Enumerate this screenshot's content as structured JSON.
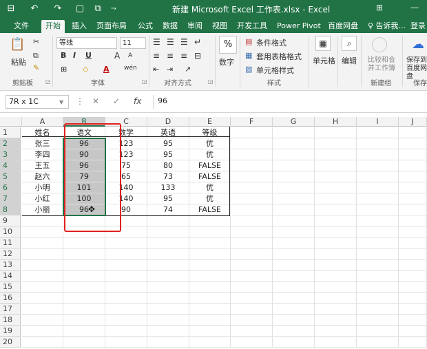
{
  "titlebar": {
    "quick_access": [
      "⊟",
      "↶",
      "↷",
      "▢",
      "⧉",
      "⇁"
    ],
    "title": "新建 Microsoft Excel 工作表.xlsx - Excel",
    "window_icon": "⊞",
    "minimize": "—"
  },
  "tabs": [
    "文件",
    "开始",
    "插入",
    "页面布局",
    "公式",
    "数据",
    "审阅",
    "视图",
    "开发工具",
    "Power Pivot",
    "百度网盘",
    "♀ 告诉我...",
    "登录"
  ],
  "active_tab": 1,
  "ribbon": {
    "clipboard": {
      "paste": "粘贴",
      "label": "剪贴板",
      "icons": [
        "✂",
        "⧉",
        "✎"
      ]
    },
    "font": {
      "name": "等线",
      "size": "11",
      "bold": "B",
      "italic": "I",
      "underline": "U",
      "grow": "A",
      "shrink": "A",
      "border_icon": "⊞",
      "fill_icon": "◇",
      "color_icon": "A",
      "phonetic": "wén",
      "label": "字体"
    },
    "alignment": {
      "label": "对齐方式"
    },
    "number": {
      "percent": "%",
      "label": "数字"
    },
    "styles": {
      "conditional": "条件格式",
      "table": "套用表格格式",
      "cell": "单元格样式",
      "label": "样式"
    },
    "cells": {
      "label": "单元格"
    },
    "editing": {
      "label": "编辑"
    },
    "compare": {
      "label": "比较和合并工作簿",
      "group": "新建组"
    },
    "save": {
      "label": "保存到百度网盘",
      "group": "保存"
    }
  },
  "formula_bar": {
    "name_box": "7R x 1C",
    "cancel": "✕",
    "enter": "✓",
    "fx": "fx",
    "value": "96"
  },
  "columns": [
    "A",
    "B",
    "C",
    "D",
    "E",
    "F",
    "G",
    "H",
    "I",
    "J"
  ],
  "rows": [
    "1",
    "2",
    "3",
    "4",
    "5",
    "6",
    "7",
    "8",
    "9",
    "10",
    "11",
    "12",
    "13",
    "14",
    "15",
    "16",
    "17",
    "18",
    "19",
    "20"
  ],
  "table": {
    "headers": [
      "姓名",
      "语文",
      "数学",
      "英语",
      "等级"
    ],
    "rows": [
      [
        "张三",
        "96",
        "123",
        "95",
        "优"
      ],
      [
        "李四",
        "90",
        "123",
        "95",
        "优"
      ],
      [
        "王五",
        "96",
        "75",
        "80",
        "FALSE"
      ],
      [
        "赵六",
        "79",
        "65",
        "73",
        "FALSE"
      ],
      [
        "小明",
        "101",
        "140",
        "133",
        "优"
      ],
      [
        "小红",
        "100",
        "140",
        "95",
        "优"
      ],
      [
        "小丽",
        "96",
        "90",
        "74",
        "FALSE"
      ]
    ]
  },
  "selection_color": "#217346",
  "highlight_color": "#e02020",
  "cursor_icon": "move-cursor-icon"
}
